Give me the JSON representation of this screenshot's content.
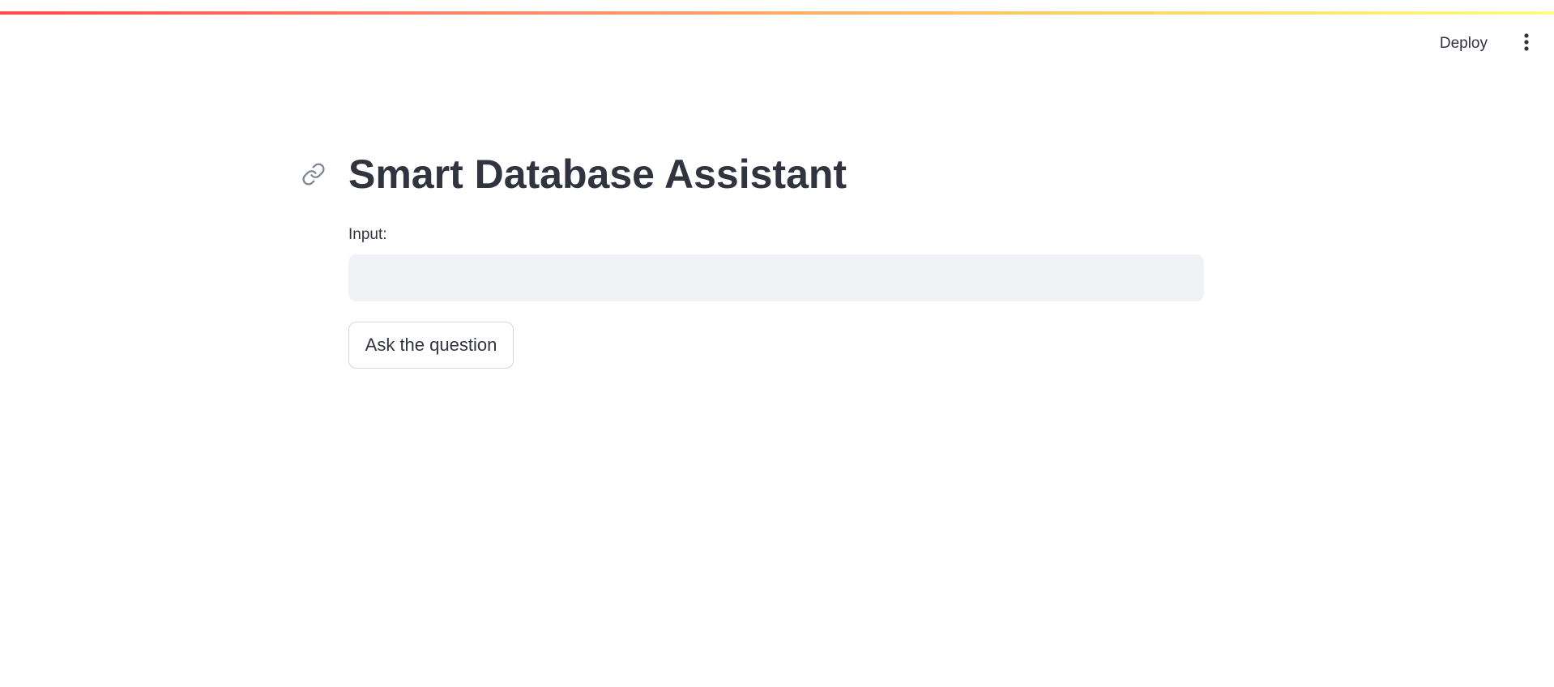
{
  "header": {
    "deploy_label": "Deploy",
    "menu_icon": "vertical-ellipsis-icon"
  },
  "main": {
    "title": "Smart Database Assistant",
    "anchor_icon": "link-icon",
    "input": {
      "label": "Input:",
      "value": "",
      "placeholder": ""
    },
    "ask_button_label": "Ask the question"
  },
  "colors": {
    "text": "#31333f",
    "input_background": "#f0f2f6",
    "button_border": "#d6d6d9",
    "decoration_start": "#ff4b4b",
    "decoration_end": "#fffd80"
  }
}
